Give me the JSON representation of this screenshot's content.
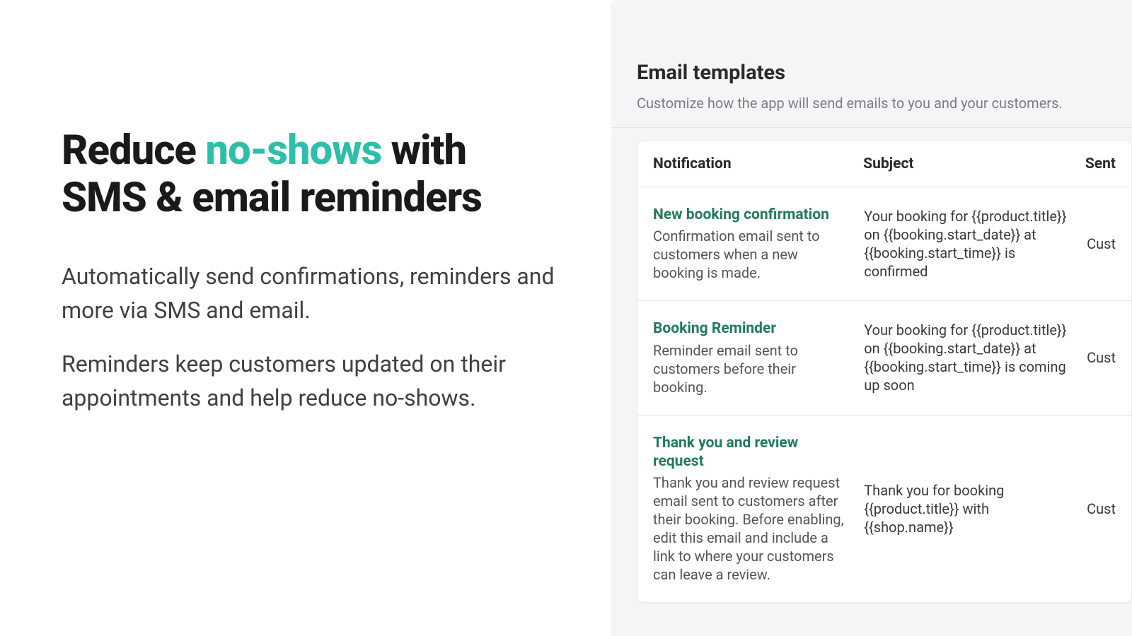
{
  "marketing": {
    "headline_part1": "Reduce ",
    "headline_accent": "no-shows",
    "headline_part2": " with SMS & email reminders",
    "paragraph1": "Automatically send confirmations, reminders and more via SMS and email.",
    "paragraph2": "Reminders keep customers updated on their appointments and help reduce no-shows."
  },
  "panel": {
    "title": "Email templates",
    "subtitle": "Customize how the app will send emails to you and your customers."
  },
  "table": {
    "headers": {
      "notification": "Notification",
      "subject": "Subject",
      "sent": "Sent"
    },
    "rows": [
      {
        "name": "New booking confirmation",
        "description": "Confirmation email sent to customers when a new booking is made.",
        "subject": "Your booking for {{product.title}} on {{booking.start_date}} at {{booking.start_time}} is confirmed",
        "sent": "Cust"
      },
      {
        "name": "Booking Reminder",
        "description": "Reminder email sent to customers before their booking.",
        "subject": "Your booking for {{product.title}} on {{booking.start_date}} at {{booking.start_time}} is coming up soon",
        "sent": "Cust"
      },
      {
        "name": "Thank you and review request",
        "description": "Thank you and review request email sent to customers after their booking. Before enabling, edit this email and include a link to where your customers can leave a review.",
        "subject": "Thank you for booking {{product.title}} with {{shop.name}}",
        "sent": "Cust"
      }
    ]
  }
}
